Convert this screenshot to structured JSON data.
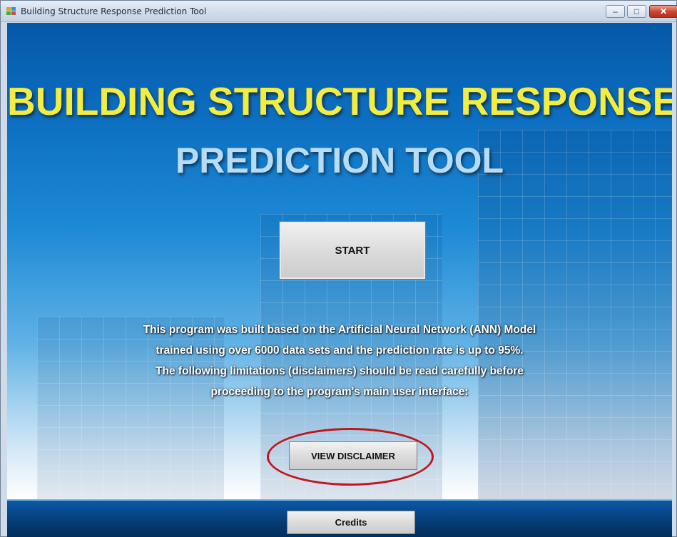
{
  "window": {
    "title": "Building Structure Response Prediction Tool",
    "controls": {
      "minimize": "–",
      "maximize": "□",
      "close": "✕"
    }
  },
  "main": {
    "title_line1": "BUILDING STRUCTURE RESPONSE",
    "title_line2": "PREDICTION TOOL",
    "start_label": "START",
    "description": [
      "This program was built based on the Artificial Neural Network (ANN) Model",
      "trained using over 6000 data sets and the prediction rate is up to 95%.",
      "The following limitations (disclaimers) should be read carefully before",
      "proceeding to the program's main user interface:"
    ],
    "disclaimer_label": "VIEW DISCLAIMER",
    "credits_label": "Credits"
  },
  "colors": {
    "title_line1": "#f3ec41",
    "title_line2": "#b8dcf5",
    "highlight_ring": "#c0151b",
    "background_top": "#0658a8"
  },
  "icons": [
    "app-icon",
    "minimize-icon",
    "maximize-icon",
    "close-icon"
  ]
}
